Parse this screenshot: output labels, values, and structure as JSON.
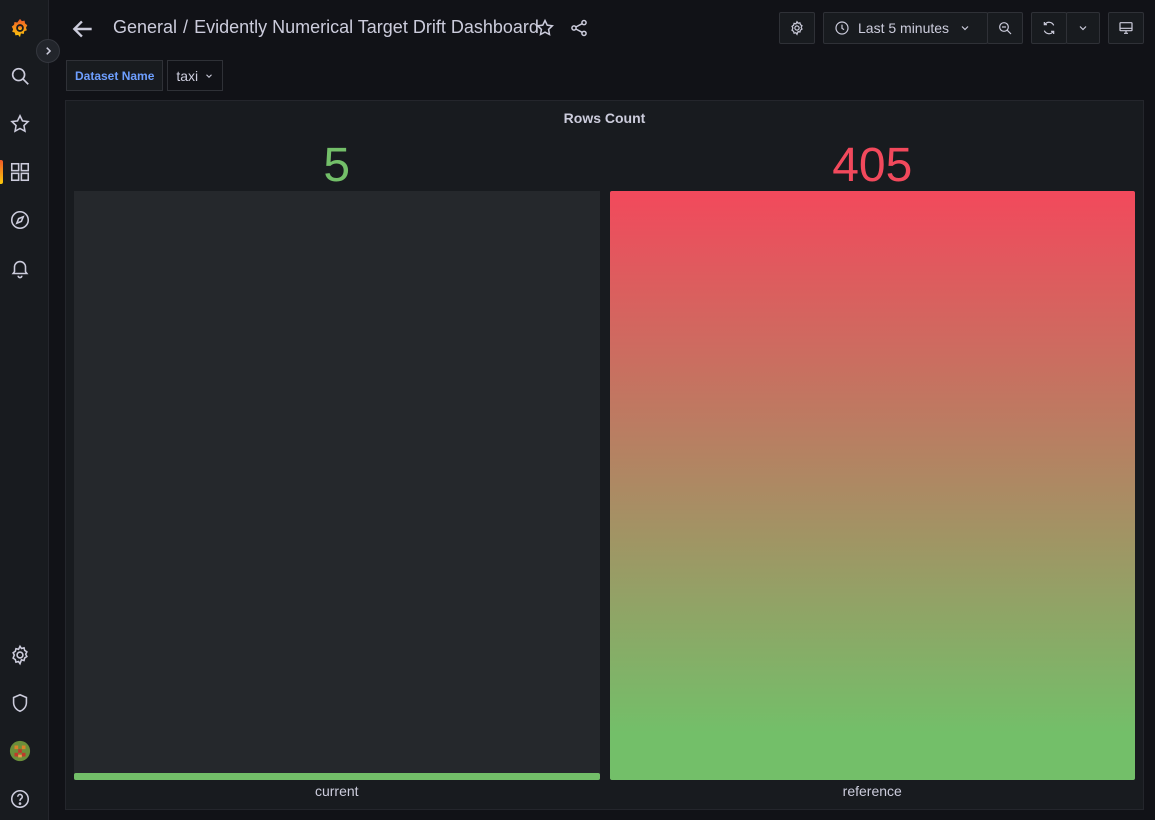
{
  "sidebar": {
    "items": [
      {
        "name": "logo-icon"
      },
      {
        "name": "search-icon"
      },
      {
        "name": "star-icon"
      },
      {
        "name": "dashboards-icon"
      },
      {
        "name": "explore-icon"
      },
      {
        "name": "alerting-bell-icon"
      },
      {
        "name": "settings-gear-icon"
      },
      {
        "name": "shield-icon"
      },
      {
        "name": "user-avatar"
      },
      {
        "name": "help-icon"
      }
    ]
  },
  "header": {
    "folder": "General",
    "separator": "/",
    "title": "Evidently Numerical Target Drift Dashboard"
  },
  "toolbar": {
    "time_range": "Last 5 minutes"
  },
  "variables": {
    "label": "Dataset Name",
    "value": "taxi"
  },
  "panel": {
    "title": "Rows Count"
  },
  "colors": {
    "green": "#73bf69",
    "red": "#f2495c",
    "track": "#25282c",
    "accent_blue": "#6e9fff"
  },
  "chart_data": {
    "type": "bar",
    "title": "Rows Count",
    "categories": [
      "current",
      "reference"
    ],
    "values": [
      5,
      405
    ],
    "value_labels": [
      "5",
      "405"
    ],
    "ylim": [
      0,
      405
    ]
  }
}
